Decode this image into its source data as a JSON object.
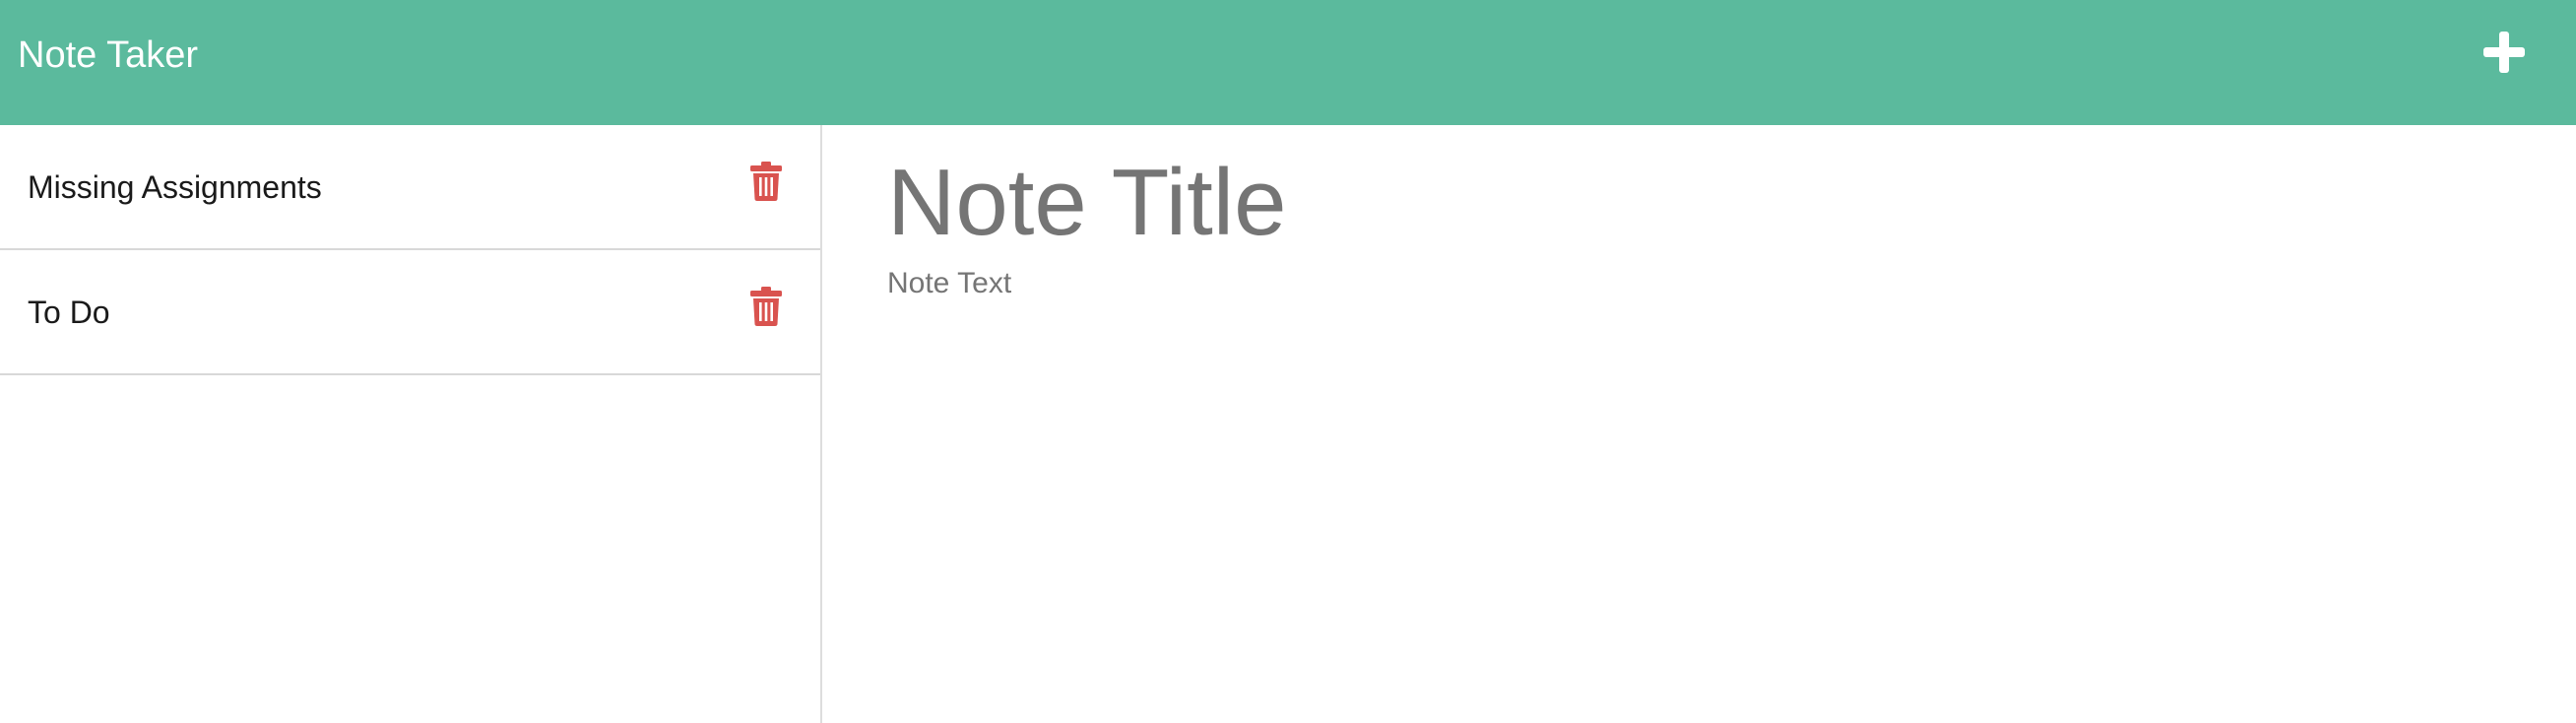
{
  "app": {
    "title": "Note Taker",
    "new_note_icon": "plus-icon",
    "accent_color": "#5bba9d"
  },
  "sidebar": {
    "notes": [
      {
        "title": "Missing Assignments",
        "delete_icon": "trash-icon"
      },
      {
        "title": "To Do",
        "delete_icon": "trash-icon"
      }
    ],
    "delete_icon_color": "#d9534f"
  },
  "editor": {
    "title_placeholder": "Note Title",
    "text_placeholder": "Note Text"
  }
}
